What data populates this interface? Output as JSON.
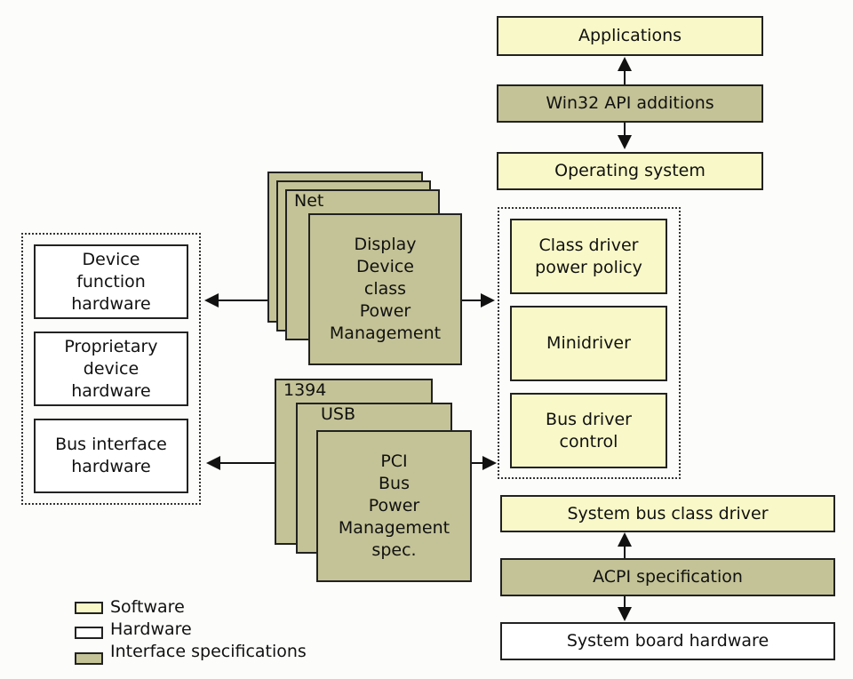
{
  "software_stack": {
    "applications": "Applications",
    "win32": "Win32 API additions",
    "os": "Operating system"
  },
  "driver_group": [
    "Class driver\npower policy",
    "Minidriver",
    "Bus driver\ncontrol"
  ],
  "hardware_group": [
    "Device\nfunction\nhardware",
    "Proprietary\ndevice\nhardware",
    "Bus interface\nhardware"
  ],
  "device_class_stack": {
    "net": "Net",
    "display": "Display\nDevice\nclass\nPower\nManagement"
  },
  "bus_stack": {
    "b1394": "1394",
    "usb": "USB",
    "pci": "PCI\nBus\nPower\nManagement\nspec."
  },
  "system_stack": {
    "bus_class": "System bus class driver",
    "acpi": "ACPI specification",
    "board": "System board hardware"
  },
  "legend": [
    {
      "label": "Software",
      "color": "#f8f8c8"
    },
    {
      "label": "Hardware",
      "color": "#ffffff"
    },
    {
      "label": "Interface specifications",
      "color": "#c4c397"
    }
  ]
}
